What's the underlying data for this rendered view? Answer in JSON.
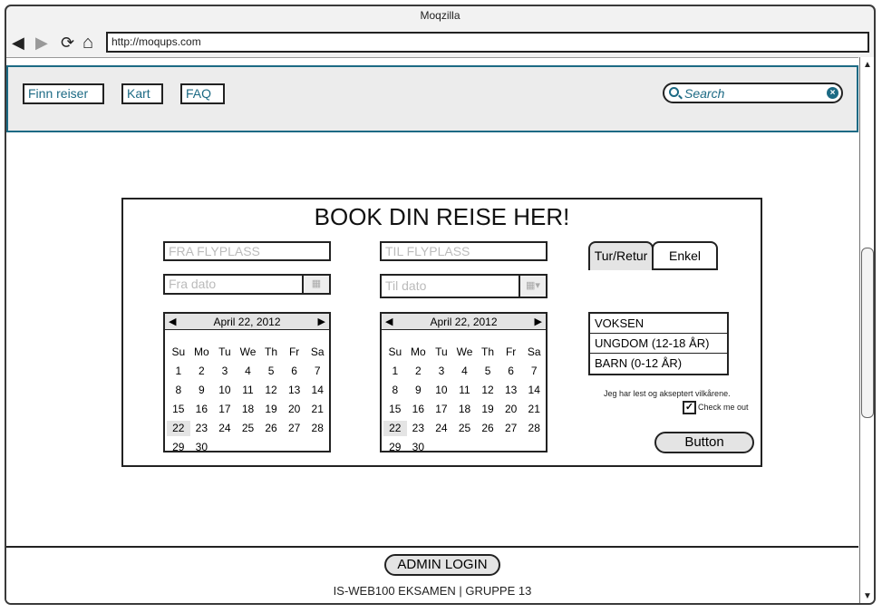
{
  "browser": {
    "title": "Moqzilla",
    "url": "http://moqups.com",
    "back_icon": "◀",
    "forward_icon": "▶",
    "reload_icon": "⟳",
    "home_icon": "⌂"
  },
  "nav": {
    "links": [
      "Finn reiser",
      "Kart",
      "FAQ"
    ],
    "search_placeholder": "Search"
  },
  "booking": {
    "title": "BOOK DIN REISE HER!",
    "from_airport_placeholder": "FRA FLYPLASS",
    "to_airport_placeholder": "TIL FLYPLASS",
    "from_date_placeholder": "Fra dato",
    "to_date_placeholder": "Til dato",
    "tabs": [
      "Tur/Retur",
      "Enkel"
    ],
    "passenger_types": [
      "VOKSEN",
      "UNGDOM (12-18 ÅR)",
      "BARN (0-12 ÅR)"
    ],
    "terms_text": "Jeg har lest og akseptert vilkårene.",
    "checkbox_label": "Check me out",
    "checkbox_checked": true,
    "button_label": "Button"
  },
  "calendar": {
    "month_label": "April 22, 2012",
    "weekdays": [
      "Su",
      "Mo",
      "Tu",
      "We",
      "Th",
      "Fr",
      "Sa"
    ],
    "days": [
      "1",
      "2",
      "3",
      "4",
      "5",
      "6",
      "7",
      "8",
      "9",
      "10",
      "11",
      "12",
      "13",
      "14",
      "15",
      "16",
      "17",
      "18",
      "19",
      "20",
      "21",
      "22",
      "23",
      "24",
      "25",
      "26",
      "27",
      "28",
      "29",
      "30"
    ],
    "selected_day": "22"
  },
  "footer": {
    "admin_label": "ADMIN LOGIN",
    "text": "IS-WEB100 EKSAMEN | GRUPPE 13"
  },
  "colors": {
    "accent": "#1c6a84",
    "border": "#222222",
    "panel_bg": "#ececec"
  }
}
